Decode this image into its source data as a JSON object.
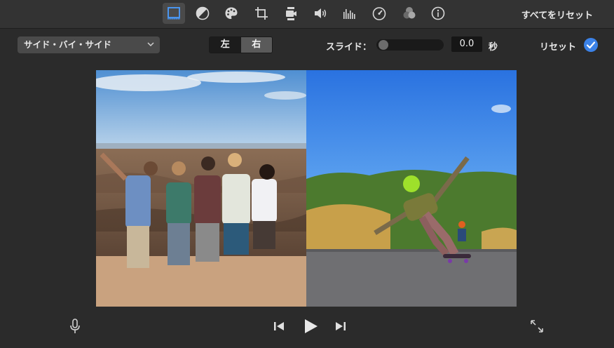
{
  "toolbar": {
    "tools": [
      {
        "icon": "crop-overlay-icon",
        "active": true
      },
      {
        "icon": "color-balance-icon"
      },
      {
        "icon": "palette-icon"
      },
      {
        "icon": "crop-icon"
      },
      {
        "icon": "video-camera-stabilization-icon"
      },
      {
        "icon": "speaker-volume-icon"
      },
      {
        "icon": "equalizer-icon"
      },
      {
        "icon": "speedometer-icon"
      },
      {
        "icon": "filter-circles-icon"
      },
      {
        "icon": "info-icon"
      }
    ],
    "reset_all_label": "すべてをリセット"
  },
  "controls": {
    "overlay_mode": "サイド・バイ・サイド",
    "position": {
      "left_label": "左",
      "right_label": "右",
      "selected": "右"
    },
    "slide_label": "スライド：",
    "slide_value": "0.0",
    "slide_unit": "秒",
    "reset_label": "リセット",
    "accent_color": "#3b82e8"
  },
  "viewer": {
    "left_clip": "group-photo-desert-canyon",
    "right_clip": "skateboarder-downhill-road"
  },
  "playback": {
    "icons": [
      "microphone-icon",
      "skip-back-icon",
      "play-icon",
      "skip-forward-icon",
      "fullscreen-icon"
    ]
  }
}
